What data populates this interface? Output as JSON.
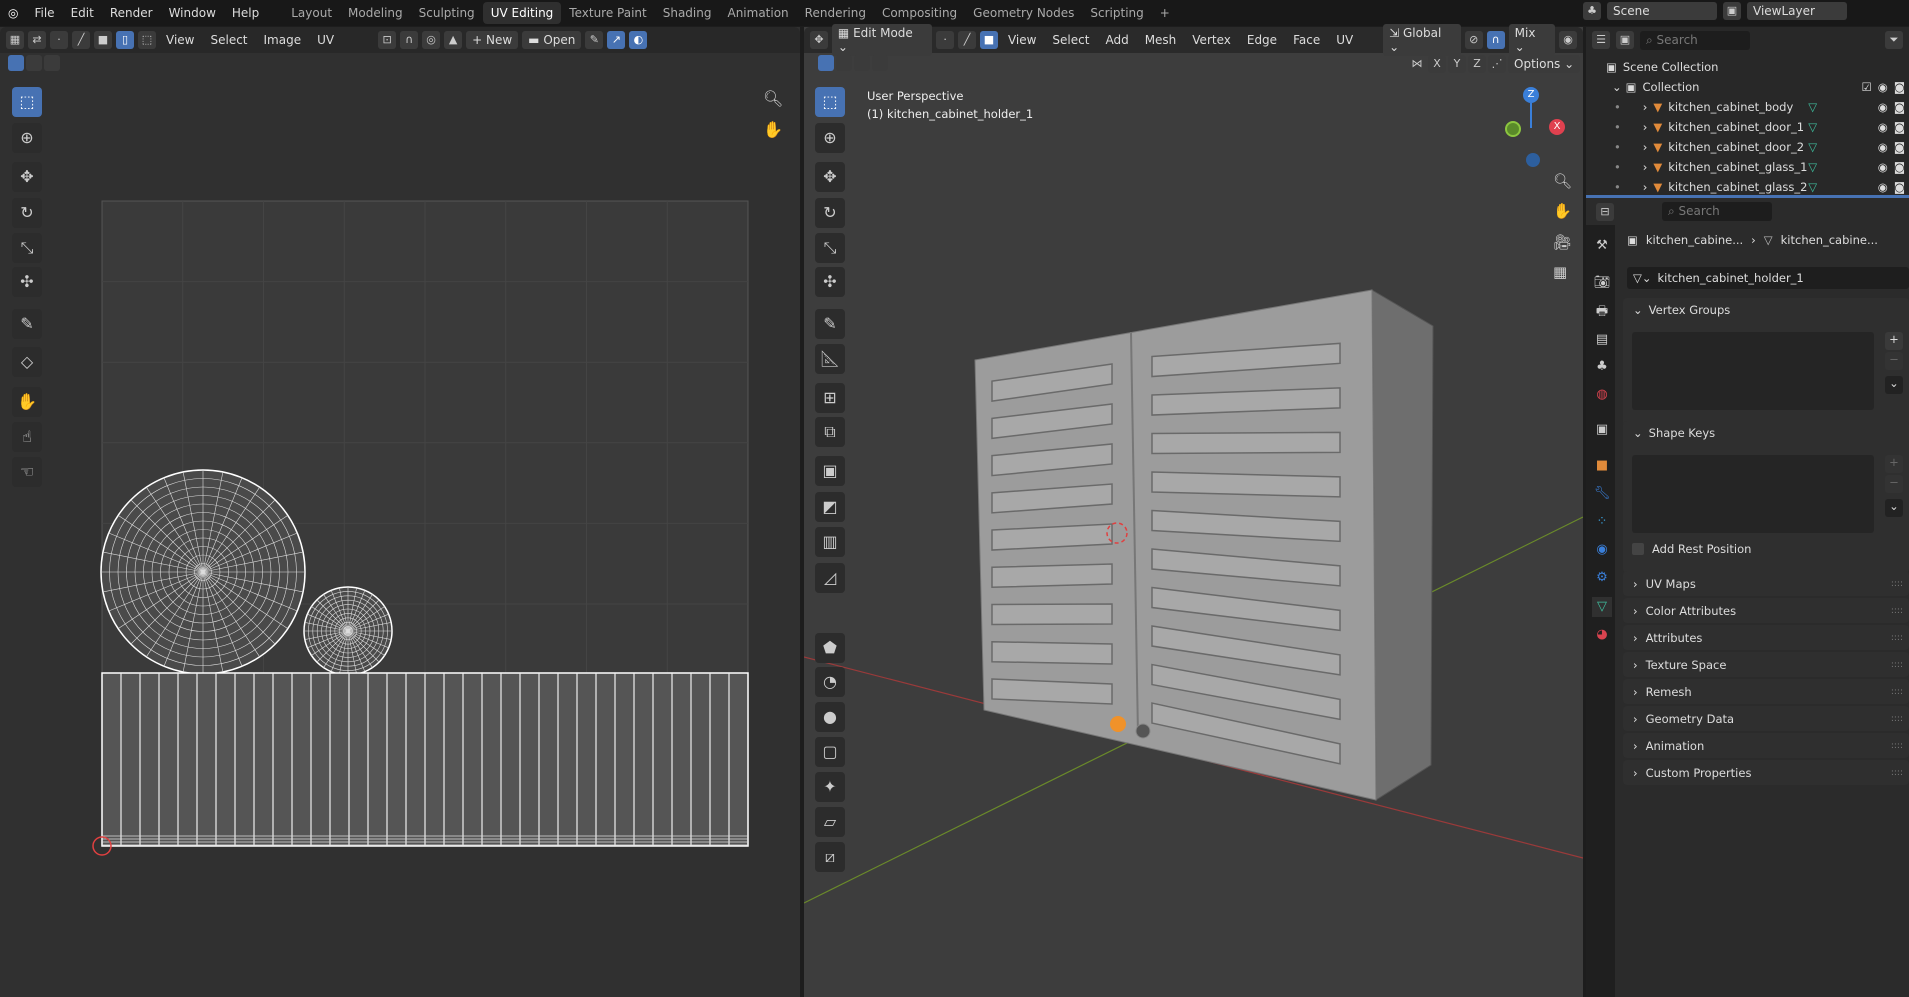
{
  "topbar": {
    "menus": [
      "File",
      "Edit",
      "Render",
      "Window",
      "Help"
    ],
    "workspaces": [
      "Layout",
      "Modeling",
      "Sculpting",
      "UV Editing",
      "Texture Paint",
      "Shading",
      "Animation",
      "Rendering",
      "Compositing",
      "Geometry Nodes",
      "Scripting"
    ],
    "active_workspace": "UV Editing",
    "add_tab": "+",
    "scene": "Scene",
    "view_layer": "ViewLayer"
  },
  "uv_editor": {
    "menus": [
      "View",
      "Select",
      "Image",
      "UV"
    ],
    "new_label": "New",
    "open_label": "Open"
  },
  "viewport": {
    "mode": "Edit Mode",
    "menus": [
      "View",
      "Select",
      "Add",
      "Mesh",
      "Vertex",
      "Edge",
      "Face",
      "UV"
    ],
    "orientation": "Global",
    "snap_mode": "Mix",
    "axes": [
      "X",
      "Y",
      "Z"
    ],
    "options_label": "Options",
    "overlay_title": "User Perspective",
    "overlay_object": "(1) kitchen_cabinet_holder_1",
    "gizmo": {
      "x": "X",
      "z": "Z"
    }
  },
  "outliner": {
    "search_placeholder": "Search",
    "scene_collection": "Scene Collection",
    "collection": "Collection",
    "items": [
      "kitchen_cabinet_body",
      "kitchen_cabinet_door_1",
      "kitchen_cabinet_door_2",
      "kitchen_cabinet_glass_1",
      "kitchen_cabinet_glass_2"
    ]
  },
  "properties": {
    "search_placeholder": "Search",
    "breadcrumb": [
      "kitchen_cabine...",
      "kitchen_cabine..."
    ],
    "mesh_name": "kitchen_cabinet_holder_1",
    "vertex_groups": "Vertex Groups",
    "shape_keys": "Shape Keys",
    "add_rest_position": "Add Rest Position",
    "add_rest_position_checked": false,
    "collapsed_panels": [
      "UV Maps",
      "Color Attributes",
      "Attributes",
      "Texture Space",
      "Remesh",
      "Geometry Data",
      "Animation",
      "Custom Properties"
    ]
  },
  "colors": {
    "accent": "#4772b3",
    "mesh_green": "#3fbf9f",
    "object_orange": "#e08a3a",
    "x_axis": "#e0414f",
    "y_axis": "#8cc63f",
    "z_axis": "#3a7fd9"
  }
}
